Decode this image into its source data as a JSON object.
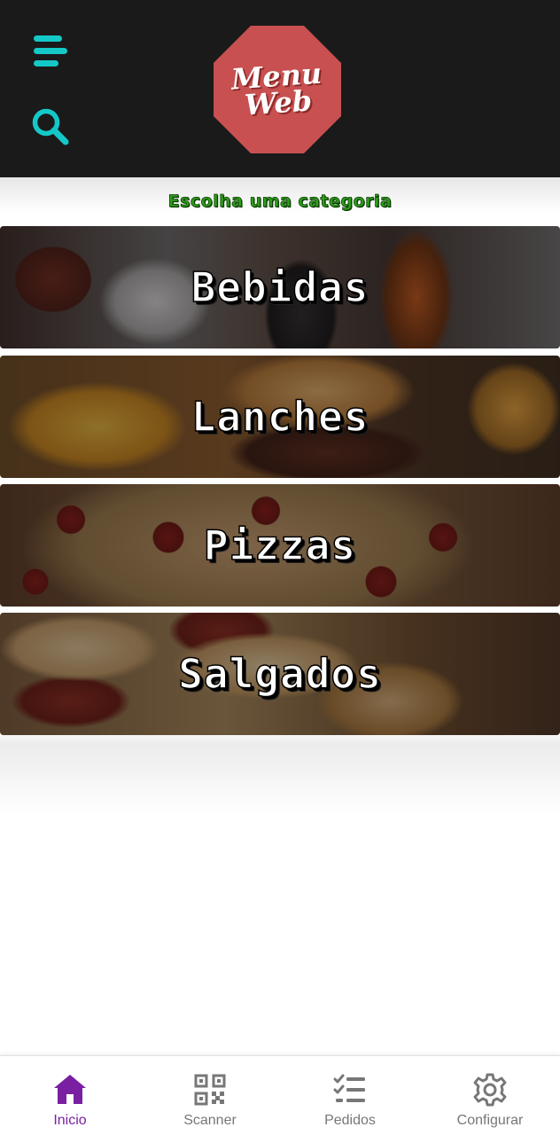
{
  "app": {
    "logo_line1": "Menu",
    "logo_line2": "Web"
  },
  "colors": {
    "header_bg": "#1a1a1a",
    "header_icon": "#14c8c8",
    "logo_bg": "#c85050",
    "section_title": "#2e9e1a",
    "nav_active": "#7a1fa2",
    "nav_inactive": "#777777"
  },
  "header": {
    "menu_icon": "menu-lines-icon",
    "search_icon": "search-icon"
  },
  "main": {
    "section_title": "Escolha uma categoria",
    "categories": [
      {
        "label": "Bebidas",
        "image": "drinks-photo"
      },
      {
        "label": "Lanches",
        "image": "burger-fries-photo"
      },
      {
        "label": "Pizzas",
        "image": "pizza-photo"
      },
      {
        "label": "Salgados",
        "image": "savory-pastries-photo"
      }
    ]
  },
  "bottom_nav": {
    "items": [
      {
        "label": "Inicio",
        "icon": "home-icon",
        "active": true
      },
      {
        "label": "Scanner",
        "icon": "qr-code-icon",
        "active": false
      },
      {
        "label": "Pedidos",
        "icon": "checklist-icon",
        "active": false
      },
      {
        "label": "Configurar",
        "icon": "gear-icon",
        "active": false
      }
    ]
  }
}
